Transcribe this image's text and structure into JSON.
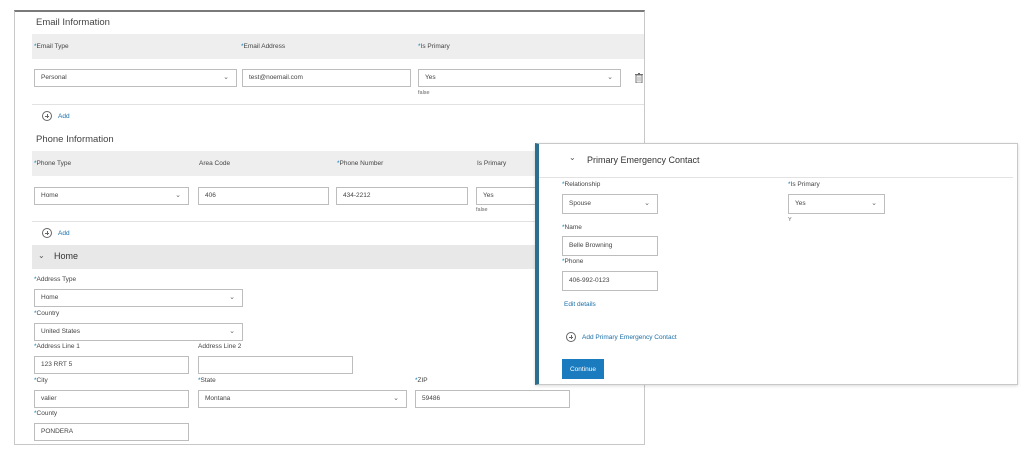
{
  "email_section": {
    "title": "Email Information",
    "headers": {
      "email_type": "Email Type",
      "email_address": "Email Address",
      "is_primary": "Is Primary"
    },
    "row": {
      "email_type": "Personal",
      "email_address": "test@noemail.com",
      "is_primary": "Yes",
      "is_primary_sub": "false"
    },
    "add_label": "Add"
  },
  "phone_section": {
    "title": "Phone Information",
    "headers": {
      "phone_type": "Phone Type",
      "area_code": "Area Code",
      "phone_number": "Phone Number",
      "is_primary": "Is Primary"
    },
    "row": {
      "phone_type": "Home",
      "area_code": "406",
      "phone_number": "434-2212",
      "is_primary": "Yes",
      "is_primary_sub": "false"
    },
    "add_label": "Add"
  },
  "address_section": {
    "title": "Home",
    "address_type_label": "Address Type",
    "address_type_value": "Home",
    "country_label": "Country",
    "country_value": "United States",
    "line1_label": "Address Line 1",
    "line1_value": "123 RRT 5",
    "line2_label": "Address Line 2",
    "line2_value": "",
    "city_label": "City",
    "city_value": "valier",
    "state_label": "State",
    "state_value": "Montana",
    "zip_label": "ZIP",
    "zip_value": "59486",
    "county_label": "County",
    "county_value": "PONDERA"
  },
  "emergency": {
    "title": "Primary Emergency Contact",
    "relationship_label": "Relationship",
    "relationship_value": "Spouse",
    "is_primary_label": "Is Primary",
    "is_primary_value": "Yes",
    "is_primary_sub": "Y",
    "name_label": "Name",
    "name_value": "Belle Browning",
    "phone_label": "Phone",
    "phone_value": "406-992-0123",
    "edit_link": "Edit details",
    "add_link": "Add Primary Emergency Contact",
    "continue_label": "Continue"
  },
  "icons": {
    "chevron": "chevron-down-icon",
    "add": "add-circle-icon",
    "trash": "trash-icon"
  },
  "colors": {
    "accent": "#1a7bbf",
    "header_bg": "#eeeeee",
    "overlay_border": "#2a6f8f"
  }
}
